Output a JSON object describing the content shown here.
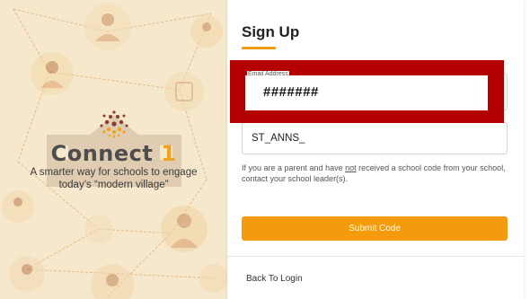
{
  "brand": {
    "logo_word": "Connect",
    "logo_number": "1",
    "tagline_line1": "A smarter way for schools to engage",
    "tagline_line2": "today’s “modern village”",
    "accent_color": "#f39c12",
    "logo_dot_colors": [
      "#8b3a2b",
      "#f0a11f"
    ]
  },
  "form": {
    "title": "Sign Up",
    "email": {
      "label": "Email Address",
      "value": "#######"
    },
    "school_code": {
      "value": "ST_ANNS_"
    },
    "help_text": {
      "before": "If you are a parent and have ",
      "emphasis": "not",
      "after": " received a school code from your school, contact your school leader(s)."
    },
    "submit_label": "Submit Code",
    "back_label": "Back To Login"
  },
  "colors": {
    "left_background": "#f6e8cc",
    "redaction": "#b30000",
    "button": "#f59a0c"
  }
}
